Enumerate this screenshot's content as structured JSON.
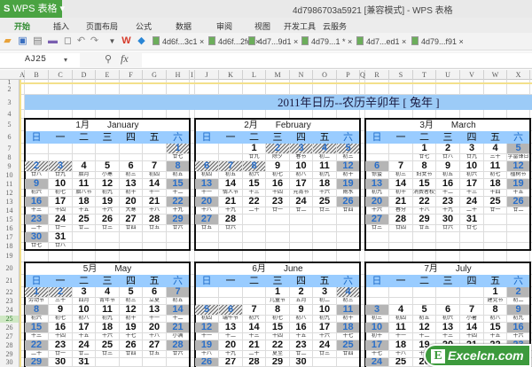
{
  "app": {
    "button_label": "WPS 表格",
    "logo_letter": "S",
    "window_title": "4d7986703a5921 [兼容模式] - WPS 表格"
  },
  "menu": [
    "开始",
    "插入",
    "页面布局",
    "公式",
    "数据",
    "审阅",
    "视图",
    "开发工具",
    "云服务"
  ],
  "toolbar_icons": [
    "open-folder-icon",
    "save-icon",
    "paste-icon",
    "print-icon",
    "print-preview-icon",
    "undo-icon",
    "redo-icon",
    "dropdown-icon",
    "wps-logo-icon",
    "cube-icon"
  ],
  "doc_tabs": [
    "4d6f...3c1 ×",
    "4d6f...2fc1×",
    "4d7...9d1 ×",
    "4d79...1 * ×",
    "4d7...ed1 ×",
    "4d79...f91 ×"
  ],
  "formula_bar": {
    "name_box": "AJ25",
    "fx_label": "fx",
    "value": ""
  },
  "columns": [
    "A",
    "B",
    "C",
    "D",
    "E",
    "F",
    "G",
    "H",
    "I",
    "J",
    "K",
    "L",
    "M",
    "N",
    "O",
    "P",
    "Q",
    "R",
    "S",
    "T",
    "U",
    "V",
    "W",
    "X"
  ],
  "rows": [
    "1",
    "2",
    "3",
    "4",
    "5",
    "6",
    "7",
    "8",
    "9",
    "10",
    "11",
    "12",
    "13",
    "14",
    "15",
    "16",
    "17",
    "18",
    "19",
    "20",
    "21",
    "22",
    "23",
    "24",
    "25",
    "26",
    "27",
    "28",
    "29",
    "30"
  ],
  "active_row": "25",
  "sheet_title": "2011年日历--农历辛卯年 [ 兔年 ]",
  "weekdays": [
    "日",
    "一",
    "二",
    "三",
    "四",
    "五",
    "六"
  ],
  "colors": {
    "header_blue": "#99ccff",
    "weekend_gray": "#b5b5b5",
    "weekend_text": "#2a6fc9",
    "app_green": "#4aa342"
  },
  "months": [
    {
      "label": "1月",
      "en": "January",
      "start": 6,
      "days": 31,
      "holidays": [
        1,
        2,
        3
      ],
      "lunar": [
        "廿七",
        "廿八",
        "廿九",
        "腊月",
        "小寒",
        "初三",
        "初四",
        "初五",
        "初六",
        "初七",
        "腊八节",
        "初九",
        "初十",
        "十一",
        "十二",
        "十三",
        "十四",
        "十五",
        "十六",
        "大寒",
        "十八",
        "十九",
        "二十",
        "廿一",
        "廿二",
        "廿三",
        "廿四",
        "廿五",
        "廿六",
        "廿七",
        "廿八"
      ]
    },
    {
      "label": "2月",
      "en": "February",
      "start": 2,
      "days": 28,
      "holidays": [
        2,
        3,
        4,
        5,
        6,
        7,
        8
      ],
      "lunar": [
        "廿九",
        "除夕",
        "春节",
        "初二",
        "初三",
        "初四",
        "初五",
        "初六",
        "初七",
        "初八",
        "初九",
        "初十",
        "十一",
        "情人节",
        "十三",
        "十四",
        "元宵节",
        "十六",
        "雨水",
        "十八",
        "十九",
        "二十",
        "廿一",
        "廿二",
        "廿三",
        "廿四",
        "廿五",
        "廿六"
      ]
    },
    {
      "label": "3月",
      "en": "March",
      "start": 2,
      "days": 31,
      "holidays": [],
      "lunar": [
        "廿七",
        "廿八",
        "廿九",
        "三十",
        "学雷锋日",
        "惊蛰",
        "初三",
        "妇女节",
        "初五",
        "初六",
        "初七",
        "植树节",
        "初九",
        "初十",
        "消费者权益日",
        "十二",
        "十三",
        "十四",
        "十五",
        "十六",
        "春分",
        "十八",
        "十九",
        "二十",
        "廿一",
        "廿二",
        "廿三",
        "廿四",
        "廿五",
        "廿六",
        "廿七"
      ]
    },
    {
      "label": "5月",
      "en": "May",
      "start": 0,
      "days": 31,
      "holidays": [
        1,
        2
      ],
      "lunar": [
        "劳动节",
        "三十",
        "四月",
        "青年节",
        "初三",
        "立夏",
        "初五",
        "初六",
        "初七",
        "初八",
        "初九",
        "初十",
        "十一",
        "十二",
        "十三",
        "十四",
        "十五",
        "十六",
        "十七",
        "十八",
        "小满",
        "二十",
        "廿一",
        "廿二",
        "廿三",
        "廿四",
        "廿五",
        "廿六"
      ]
    },
    {
      "label": "6月",
      "en": "June",
      "start": 3,
      "days": 30,
      "holidays": [
        4,
        5,
        6
      ],
      "lunar": [
        "儿童节",
        "五月",
        "初二",
        "初三",
        "初四",
        "端午节",
        "初六",
        "初七",
        "初八",
        "初九",
        "初十",
        "十一",
        "十二",
        "十三",
        "十四",
        "十五",
        "十六",
        "十七",
        "十八",
        "十九",
        "二十",
        "夏至",
        "廿二",
        "廿三",
        "廿四"
      ]
    },
    {
      "label": "7月",
      "en": "July",
      "start": 5,
      "days": 30,
      "holidays": [],
      "lunar": [
        "建党节",
        "初二",
        "初三",
        "初四",
        "初五",
        "初六",
        "小暑",
        "初八",
        "初九",
        "初十",
        "十一",
        "十二",
        "十三",
        "十四",
        "十五",
        "十六",
        "十七",
        "十八",
        "十九",
        "二十",
        "廿一",
        "廿二",
        "廿三"
      ]
    }
  ],
  "watermark": {
    "letter": "E",
    "text": "Excelcn.com"
  }
}
